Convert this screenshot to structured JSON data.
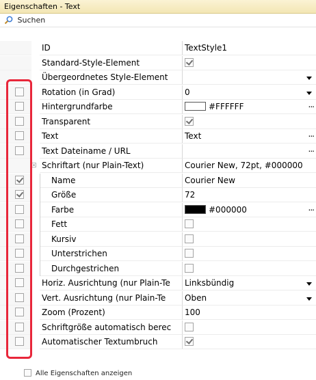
{
  "panel": {
    "title": "Eigenschaften - Text",
    "search_label": "Suchen"
  },
  "rows": [
    {
      "name": "ID",
      "value": "TextStyle1",
      "check": null,
      "value_type": "text"
    },
    {
      "name": "Standard-Style-Element",
      "value": "",
      "check": null,
      "value_type": "checkbox",
      "value_checked": true
    },
    {
      "name": "Übergeordnetes Style-Element",
      "value": "",
      "check": null,
      "value_type": "dropdown"
    },
    {
      "name": "Rotation (in Grad)",
      "value": "0",
      "check": false,
      "value_type": "dropdown"
    },
    {
      "name": "Hintergrundfarbe",
      "value": "#FFFFFF",
      "check": false,
      "value_type": "color",
      "color": "#FFFFFF"
    },
    {
      "name": "Transparent",
      "value": "",
      "check": false,
      "value_type": "checkbox",
      "value_checked": true
    },
    {
      "name": "Text",
      "value": "Text",
      "check": false,
      "value_type": "ellipsis"
    },
    {
      "name": "Text Dateiname / URL",
      "value": "",
      "check": false,
      "value_type": "ellipsis"
    },
    {
      "name": "Schriftart (nur Plain-Text)",
      "value": "Courier New, 72pt, #000000",
      "check": null,
      "value_type": "text",
      "expander": true
    },
    {
      "name": "Name",
      "value": "Courier New",
      "check": true,
      "value_type": "text",
      "sub": true
    },
    {
      "name": "Größe",
      "value": "72",
      "check": true,
      "value_type": "text",
      "sub": true
    },
    {
      "name": "Farbe",
      "value": "#000000",
      "check": false,
      "value_type": "color",
      "color": "#000000",
      "sub": true
    },
    {
      "name": "Fett",
      "value": "",
      "check": false,
      "value_type": "checkbox",
      "value_checked": false,
      "sub": true
    },
    {
      "name": "Kursiv",
      "value": "",
      "check": false,
      "value_type": "checkbox",
      "value_checked": false,
      "sub": true
    },
    {
      "name": "Unterstrichen",
      "value": "",
      "check": false,
      "value_type": "checkbox",
      "value_checked": false,
      "sub": true
    },
    {
      "name": "Durchgestrichen",
      "value": "",
      "check": false,
      "value_type": "checkbox",
      "value_checked": false,
      "sub": true
    },
    {
      "name": "Horiz. Ausrichtung (nur Plain-Te",
      "value": "Linksbündig",
      "check": false,
      "value_type": "dropdown"
    },
    {
      "name": "Vert. Ausrichtung (nur Plain-Te",
      "value": "Oben",
      "check": false,
      "value_type": "dropdown"
    },
    {
      "name": "Zoom (Prozent)",
      "value": "100",
      "check": false,
      "value_type": "text"
    },
    {
      "name": "Schriftgröße automatisch berec",
      "value": "",
      "check": false,
      "value_type": "checkbox",
      "value_checked": false
    },
    {
      "name": "Automatischer Textumbruch",
      "value": "",
      "check": false,
      "value_type": "checkbox",
      "value_checked": true
    }
  ],
  "footer": {
    "show_all_label": "Alle Eigenschaften anzeigen"
  },
  "colors": {
    "highlight": "#e8263a",
    "title_bg": "#f3e6b4"
  },
  "icons": {
    "search": "search-icon",
    "check": "checkmark-icon",
    "dropdown": "chevron-down-icon",
    "ellipsis": "ellipsis-icon",
    "expander": "collapse-icon"
  }
}
